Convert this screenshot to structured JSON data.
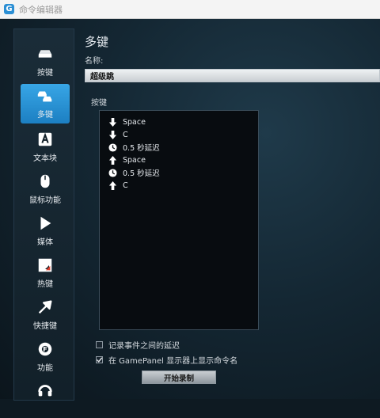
{
  "window": {
    "title": "命令编辑器"
  },
  "sidebar": {
    "items": [
      {
        "label": "按键",
        "icon": "key-icon",
        "active": false
      },
      {
        "label": "多键",
        "icon": "multikey-icon",
        "active": true
      },
      {
        "label": "文本块",
        "icon": "text-block-icon",
        "active": false
      },
      {
        "label": "鼠标功能",
        "icon": "mouse-icon",
        "active": false
      },
      {
        "label": "媒体",
        "icon": "play-icon",
        "active": false
      },
      {
        "label": "热键",
        "icon": "hotkey-icon",
        "active": false
      },
      {
        "label": "快捷键",
        "icon": "shortcut-arrow-icon",
        "active": false
      },
      {
        "label": "功能",
        "icon": "function-icon",
        "active": false
      },
      {
        "label": "",
        "icon": "headset-icon",
        "active": false
      }
    ]
  },
  "main": {
    "heading": "多键",
    "name_label": "名称:",
    "name_value": "超级跳",
    "keys_label": "按键",
    "macro_steps": [
      {
        "type": "key-down",
        "icon": "arrow-down-icon",
        "text": "Space"
      },
      {
        "type": "key-down",
        "icon": "arrow-down-icon",
        "text": "C"
      },
      {
        "type": "delay",
        "icon": "clock-icon",
        "text": "0.5 秒延迟"
      },
      {
        "type": "key-up",
        "icon": "arrow-up-icon",
        "text": "Space"
      },
      {
        "type": "delay",
        "icon": "clock-icon",
        "text": "0.5 秒延迟"
      },
      {
        "type": "key-up",
        "icon": "arrow-up-icon",
        "text": "C"
      }
    ],
    "options": {
      "record_delays": {
        "label": "记录事件之间的延迟",
        "checked": false
      },
      "show_on_gamepanel": {
        "label": "在 GamePanel 显示器上显示命令名",
        "checked": true
      }
    },
    "record_button": "开始录制"
  },
  "colors": {
    "accent": "#2b8fd4",
    "background": "#0e1a22"
  }
}
